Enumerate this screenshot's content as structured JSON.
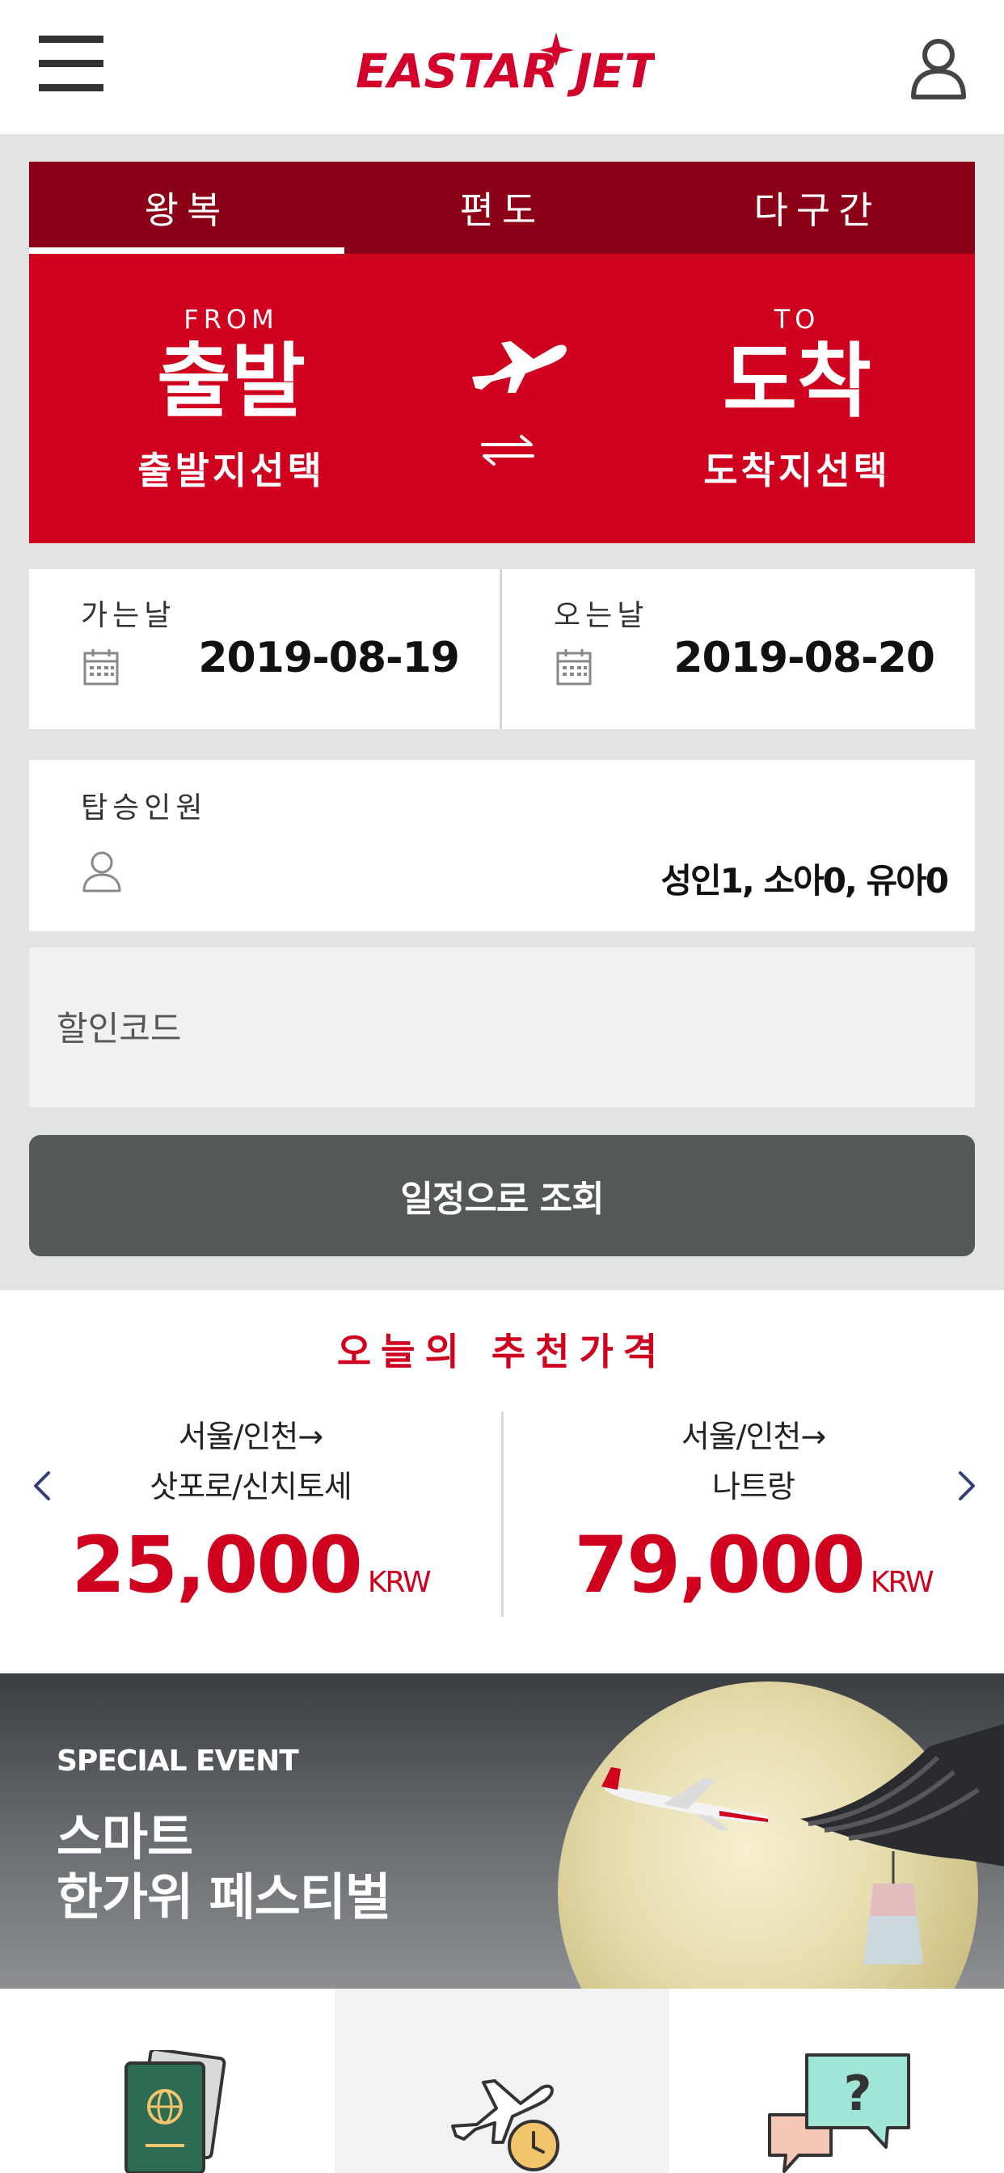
{
  "header": {
    "logo_text": "EASTAR JET",
    "menu_icon": "hamburger-menu-icon",
    "user_icon": "user-icon"
  },
  "trip_types": [
    {
      "label": "왕복",
      "active": true
    },
    {
      "label": "편도",
      "active": false
    },
    {
      "label": "다구간",
      "active": false
    }
  ],
  "route": {
    "from_label": "FROM",
    "from_city": "출발",
    "from_select": "출발지선택",
    "to_label": "TO",
    "to_city": "도착",
    "to_select": "도착지선택"
  },
  "dates": {
    "depart_label": "가는날",
    "depart_value": "2019-08-19",
    "return_label": "오는날",
    "return_value": "2019-08-20"
  },
  "passengers": {
    "label": "탑승인원",
    "value": "성인1, 소아0, 유아0"
  },
  "promo": {
    "placeholder": "할인코드",
    "value": ""
  },
  "search_button": "일정으로 조회",
  "recommend": {
    "title": "오늘의 추천가격",
    "cards": [
      {
        "route1": "서울/인천→",
        "route2": "삿포로/신치토세",
        "price": "25,000",
        "currency": "KRW"
      },
      {
        "route1": "서울/인천→",
        "route2": "나트랑",
        "price": "79,000",
        "currency": "KRW"
      }
    ]
  },
  "banner": {
    "eyebrow": "SPECIAL EVENT",
    "title_line1": "스마트",
    "title_line2": "한가위 페스티벌"
  },
  "colors": {
    "brand_red": "#d0011f",
    "tab_dark_red": "#8c0017",
    "button_gray": "#555859",
    "page_gray": "#e2e3e5"
  }
}
